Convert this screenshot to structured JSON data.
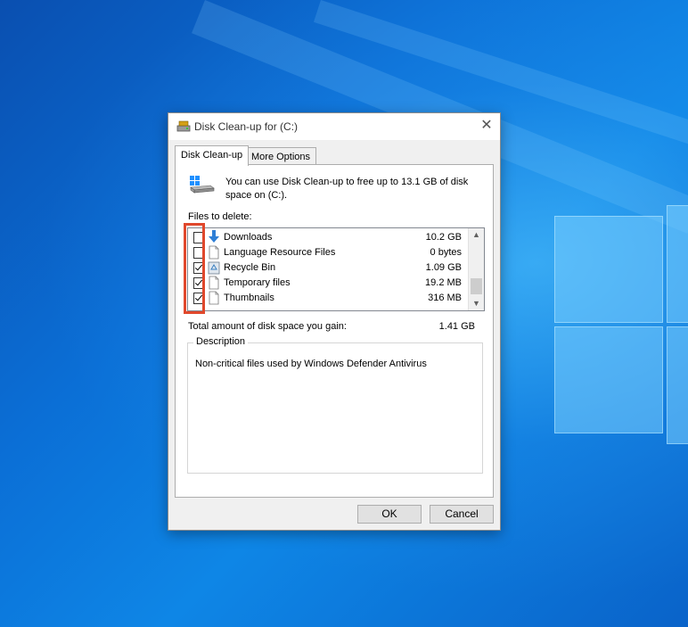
{
  "window": {
    "title": "Disk Clean-up for  (C:)",
    "close_glyph": "✕"
  },
  "tabs": [
    {
      "label": "Disk Clean-up",
      "active": true
    },
    {
      "label": "More Options",
      "active": false
    }
  ],
  "intro_text": "You can use Disk Clean-up to free up to 13.1 GB of disk space on  (C:).",
  "files_label": "Files to delete:",
  "files": [
    {
      "name": "Downloads",
      "size": "10.2 GB",
      "checked": false,
      "icon": "download-arrow-icon"
    },
    {
      "name": "Language Resource Files",
      "size": "0 bytes",
      "checked": false,
      "icon": "file-icon"
    },
    {
      "name": "Recycle Bin",
      "size": "1.09 GB",
      "checked": true,
      "icon": "recycle-bin-icon"
    },
    {
      "name": "Temporary files",
      "size": "19.2 MB",
      "checked": true,
      "icon": "file-icon"
    },
    {
      "name": "Thumbnails",
      "size": "316 MB",
      "checked": true,
      "icon": "file-icon"
    }
  ],
  "total_label": "Total amount of disk space you gain:",
  "total_value": "1.41 GB",
  "description": {
    "legend": "Description",
    "text": "Non-critical files used by Windows Defender Antivirus"
  },
  "buttons": {
    "ok": "OK",
    "cancel": "Cancel"
  },
  "colors": {
    "highlight": "#e0482c",
    "download_arrow": "#2f7fd6",
    "desktop": "#0b6fd6"
  }
}
